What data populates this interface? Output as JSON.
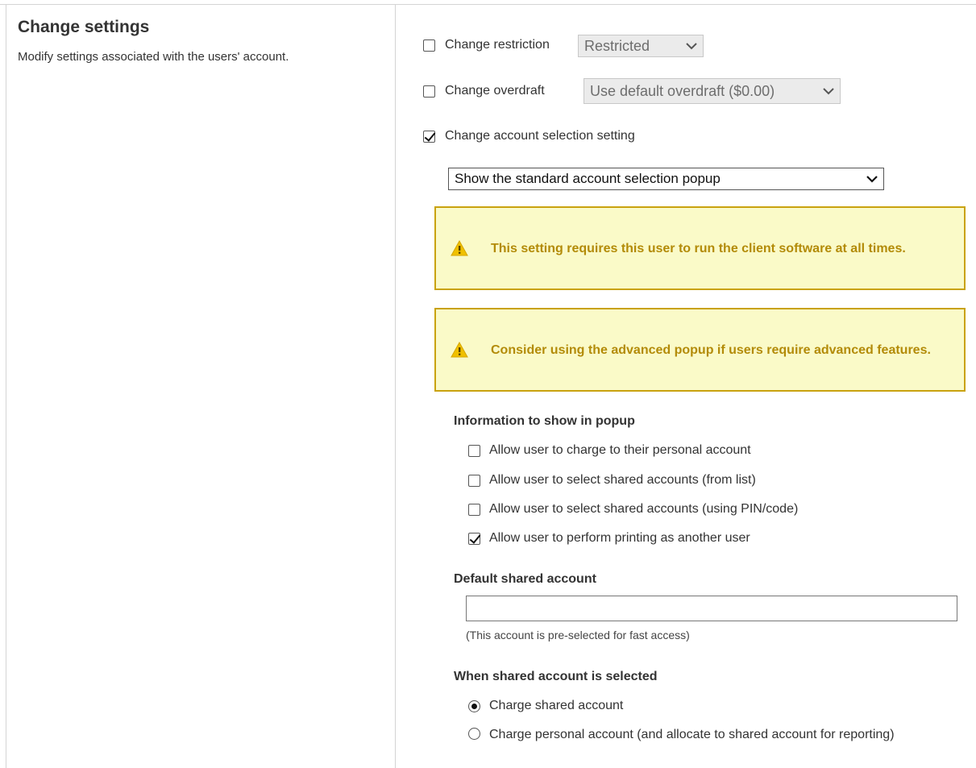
{
  "left": {
    "title": "Change settings",
    "description": "Modify settings associated with the users' account."
  },
  "restriction": {
    "label": "Change restriction",
    "checked": false,
    "value": "Restricted"
  },
  "overdraft": {
    "label": "Change overdraft",
    "checked": false,
    "value": "Use default overdraft ($0.00)"
  },
  "account_selection": {
    "label": "Change account selection setting",
    "checked": true,
    "value": "Show the standard account selection popup"
  },
  "warnings": [
    {
      "text": "This setting requires this user to run the client software at all times.",
      "icon": "warning-icon"
    },
    {
      "text": "Consider using the advanced popup if users require advanced features.",
      "icon": "warning-icon"
    }
  ],
  "popup_info": {
    "heading": "Information to show in popup",
    "options": [
      {
        "label": "Allow user to charge to their personal account",
        "checked": false
      },
      {
        "label": "Allow user to select shared accounts (from list)",
        "checked": false
      },
      {
        "label": "Allow user to select shared accounts (using PIN/code)",
        "checked": false
      },
      {
        "label": "Allow user to perform printing as another user",
        "checked": true
      }
    ]
  },
  "default_shared": {
    "heading": "Default shared account",
    "value": "",
    "hint": "(This account is pre-selected for fast access)"
  },
  "shared_selected": {
    "heading": "When shared account is selected",
    "options": [
      {
        "label": "Charge shared account",
        "checked": true
      },
      {
        "label": "Charge personal account (and allocate to shared account for reporting)",
        "checked": false
      }
    ]
  },
  "colors": {
    "warning_bg": "#fafac8",
    "warning_border": "#c9a20f",
    "warning_text": "#b38b08",
    "disabled_select_bg": "#ebebeb"
  }
}
